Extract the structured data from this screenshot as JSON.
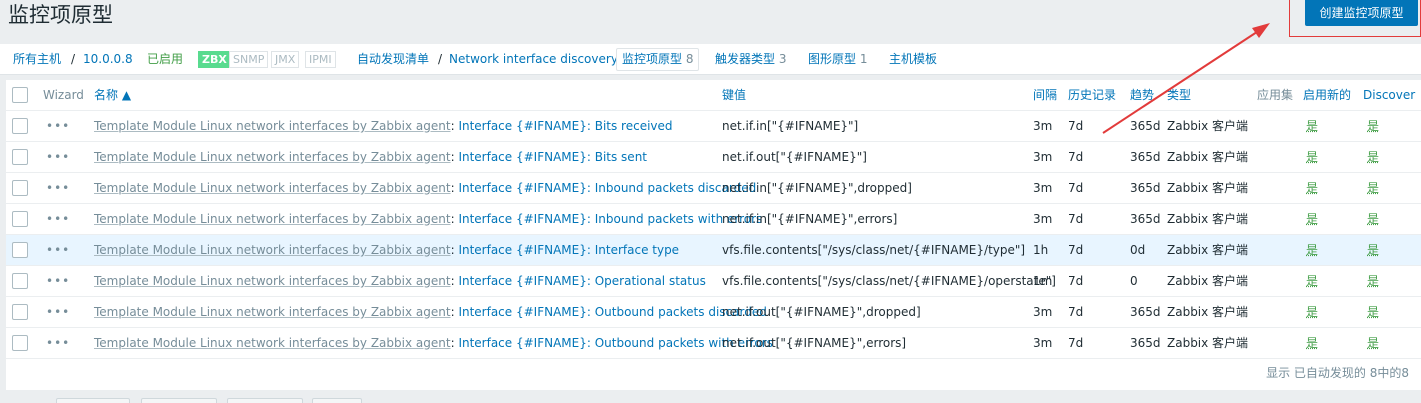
{
  "page": {
    "title": "监控项原型",
    "create_button": "创建监控项原型"
  },
  "nav": {
    "all_hosts": "所有主机",
    "slash": "/",
    "host": "10.0.0.8",
    "status": "已启用",
    "tags": [
      "ZBX",
      "SNMP",
      "JMX",
      "IPMI"
    ],
    "discovery_list": "自动发现清单",
    "discovery_rule": "Network interface discovery",
    "item_prototypes": {
      "label": "监控项原型",
      "count": "8"
    },
    "trigger_prototypes": {
      "label": "触发器类型",
      "count": "3"
    },
    "graph_prototypes": {
      "label": "图形原型",
      "count": "1"
    },
    "host_prototypes": {
      "label": "主机模板"
    }
  },
  "table": {
    "headers": {
      "wizard": "Wizard",
      "name": "名称 ▲",
      "key": "键值",
      "interval": "间隔",
      "history": "历史记录",
      "trends": "趋势",
      "type": "类型",
      "applications": "应用集",
      "create_enabled": "启用新的",
      "discover": "Discover"
    },
    "rows": [
      {
        "dots": "•••",
        "template": "Template Module Linux network interfaces by Zabbix agent",
        "colon": ":",
        "name": "Interface {#IFNAME}: Bits received",
        "key": "net.if.in[\"{#IFNAME}\"]",
        "interval": "3m",
        "history": "7d",
        "trends": "365d",
        "type": "Zabbix 客户端",
        "create_enabled": "是",
        "discover": "是"
      },
      {
        "dots": "•••",
        "template": "Template Module Linux network interfaces by Zabbix agent",
        "colon": ":",
        "name": "Interface {#IFNAME}: Bits sent",
        "key": "net.if.out[\"{#IFNAME}\"]",
        "interval": "3m",
        "history": "7d",
        "trends": "365d",
        "type": "Zabbix 客户端",
        "create_enabled": "是",
        "discover": "是"
      },
      {
        "dots": "•••",
        "template": "Template Module Linux network interfaces by Zabbix agent",
        "colon": ":",
        "name": "Interface {#IFNAME}: Inbound packets discarded",
        "key": "net.if.in[\"{#IFNAME}\",dropped]",
        "interval": "3m",
        "history": "7d",
        "trends": "365d",
        "type": "Zabbix 客户端",
        "create_enabled": "是",
        "discover": "是"
      },
      {
        "dots": "•••",
        "template": "Template Module Linux network interfaces by Zabbix agent",
        "colon": ":",
        "name": "Interface {#IFNAME}: Inbound packets with errors",
        "key": "net.if.in[\"{#IFNAME}\",errors]",
        "interval": "3m",
        "history": "7d",
        "trends": "365d",
        "type": "Zabbix 客户端",
        "create_enabled": "是",
        "discover": "是"
      },
      {
        "dots": "•••",
        "template": "Template Module Linux network interfaces by Zabbix agent",
        "colon": ":",
        "name": "Interface {#IFNAME}: Interface type",
        "key": "vfs.file.contents[\"/sys/class/net/{#IFNAME}/type\"]",
        "interval": "1h",
        "history": "7d",
        "trends": "0d",
        "type": "Zabbix 客户端",
        "create_enabled": "是",
        "discover": "是"
      },
      {
        "dots": "•••",
        "template": "Template Module Linux network interfaces by Zabbix agent",
        "colon": ":",
        "name": "Interface {#IFNAME}: Operational status",
        "key": "vfs.file.contents[\"/sys/class/net/{#IFNAME}/operstate\"]",
        "interval": "1m",
        "history": "7d",
        "trends": "0",
        "type": "Zabbix 客户端",
        "create_enabled": "是",
        "discover": "是"
      },
      {
        "dots": "•••",
        "template": "Template Module Linux network interfaces by Zabbix agent",
        "colon": ":",
        "name": "Interface {#IFNAME}: Outbound packets discarded",
        "key": "net.if.out[\"{#IFNAME}\",dropped]",
        "interval": "3m",
        "history": "7d",
        "trends": "365d",
        "type": "Zabbix 客户端",
        "create_enabled": "是",
        "discover": "是"
      },
      {
        "dots": "•••",
        "template": "Template Module Linux network interfaces by Zabbix agent",
        "colon": ":",
        "name": "Interface {#IFNAME}: Outbound packets with errors",
        "key": "net.if.out[\"{#IFNAME}\",errors]",
        "interval": "3m",
        "history": "7d",
        "trends": "365d",
        "type": "Zabbix 客户端",
        "create_enabled": "是",
        "discover": "是"
      }
    ],
    "footer": "显示 已自动发现的 8中的8"
  },
  "colors": {
    "accent": "#0275b8",
    "enabled": "#429e47",
    "annotation": "#e23b3b"
  }
}
